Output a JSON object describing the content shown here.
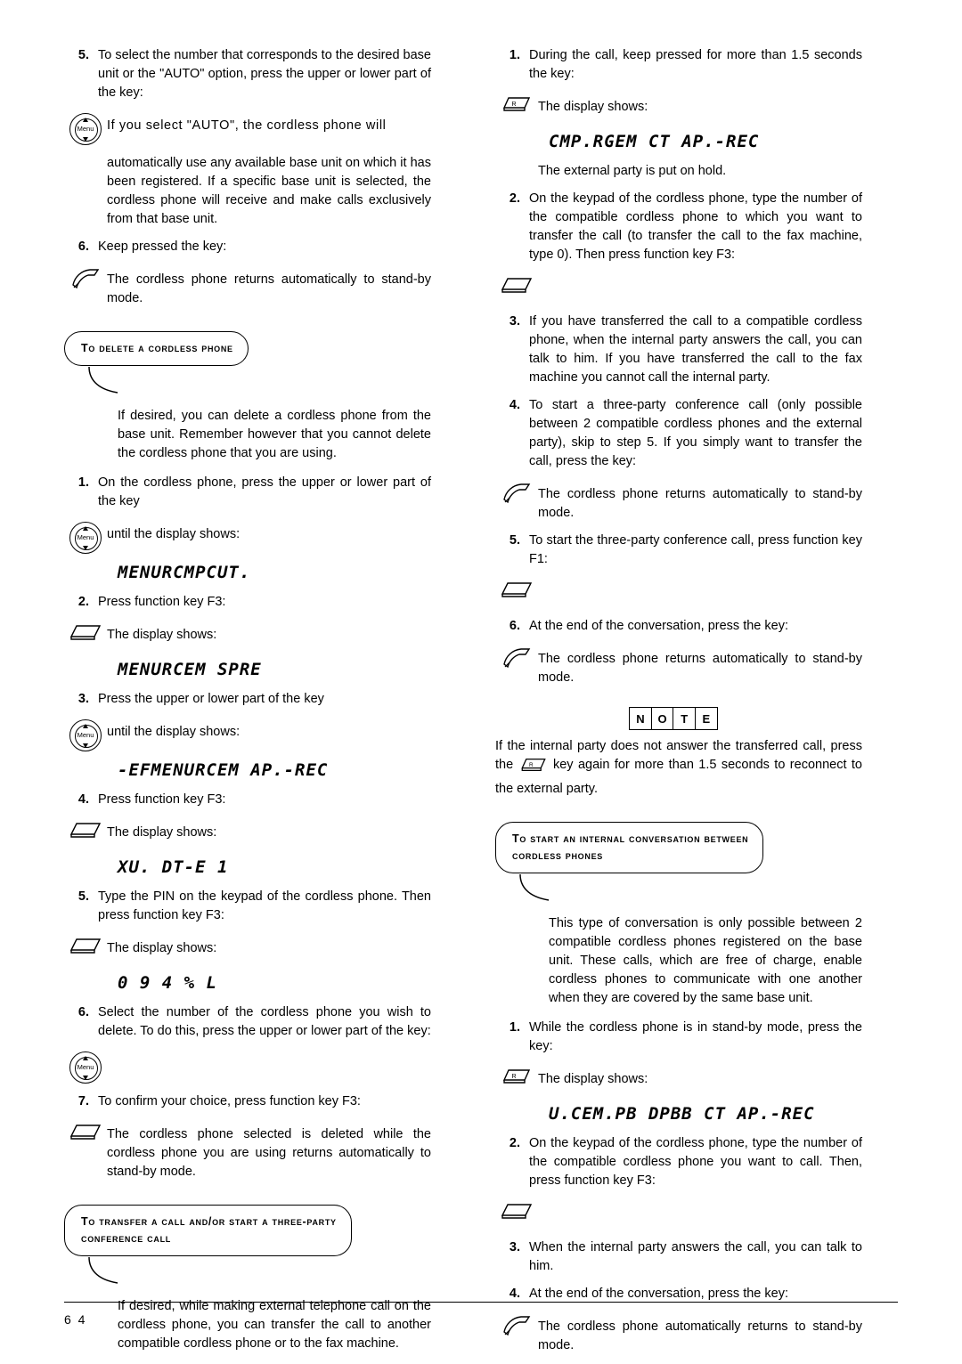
{
  "page": {
    "number": "6 4"
  },
  "left": {
    "items": [
      {
        "type": "num",
        "num": "5.",
        "text": "To select the number that corresponds to the desired base unit or the \"AUTO\" option, press the upper or lower part of the key:"
      },
      {
        "type": "icon",
        "icon": "menu-navigation-key-icon",
        "text": "If you select \"AUTO\", the cordless phone will"
      },
      {
        "type": "plain",
        "text": "automatically use any available base unit on which it has been registered. If a specific base unit is selected, the cordless phone will receive and make calls exclusively from that base unit."
      },
      {
        "type": "num",
        "num": "6.",
        "text": "Keep pressed the key:"
      },
      {
        "type": "icon",
        "icon": "hook-hangup-key-icon",
        "text": "The cordless phone returns automatically to stand-by mode."
      }
    ],
    "section1": {
      "heading": "To delete a cordless phone",
      "body": "If desired, you can delete a cordless phone from the base unit. Remember however that you cannot delete the cordless phone that you are using.",
      "items": [
        {
          "type": "num",
          "num": "1.",
          "text": "On the cordless phone, press the upper or lower part of the key"
        },
        {
          "type": "icon",
          "icon": "menu-navigation-key-icon",
          "text": "until the display shows:"
        },
        {
          "type": "lcd",
          "text": "MENURCMPCUT."
        },
        {
          "type": "num",
          "num": "2.",
          "text": "Press function key F3:"
        },
        {
          "type": "icon",
          "icon": "function-key-f3-icon",
          "text": "The display shows:"
        },
        {
          "type": "lcd",
          "text": "MENURCEM SPRE"
        },
        {
          "type": "num",
          "num": "3.",
          "text": "Press the upper or lower part of the key"
        },
        {
          "type": "icon",
          "icon": "menu-navigation-key-icon",
          "text": "until the display shows:"
        },
        {
          "type": "lcd",
          "text": "-EFMENURCEM AP.-REC"
        },
        {
          "type": "num",
          "num": "4.",
          "text": "Press function key F3:"
        },
        {
          "type": "icon",
          "icon": "function-key-f3-icon",
          "text": "The display shows:"
        },
        {
          "type": "lcd",
          "text": "XU. DT-E 1"
        },
        {
          "type": "num",
          "num": "5.",
          "text": "Type the PIN on the keypad of the cordless phone. Then press function key F3:"
        },
        {
          "type": "icon",
          "icon": "function-key-f3-icon",
          "text": "The display shows:"
        },
        {
          "type": "lcd",
          "text": "0 9 4 % L"
        },
        {
          "type": "num",
          "num": "6.",
          "text": "Select the number of the cordless phone you wish to delete. To do this, press the upper or lower part of the key:"
        },
        {
          "type": "icononly",
          "icon": "menu-navigation-key-icon",
          "text": ""
        },
        {
          "type": "num",
          "num": "7.",
          "text": "To confirm your choice, press function key F3:"
        },
        {
          "type": "icon",
          "icon": "function-key-f3-icon",
          "text": "The cordless phone selected is deleted while the cordless phone you are using returns automatically to stand-by mode."
        }
      ]
    },
    "section2": {
      "heading_line1": "To transfer a call and/or start a three-party",
      "heading_line2": "conference call",
      "body": "If desired, while making external telephone call on the cordless phone, you can transfer the call to another compatible cordless phone or to the fax machine."
    }
  },
  "right": {
    "items": [
      {
        "type": "num",
        "num": "1.",
        "text": "During the call, keep pressed for more than 1.5 seconds the key:"
      },
      {
        "type": "icon",
        "icon": "r-recall-key-icon",
        "text": "The display shows:"
      },
      {
        "type": "lcd",
        "text": "CMP.RGEM CT AP.-REC"
      },
      {
        "type": "plain",
        "text": "The external party is put on hold."
      },
      {
        "type": "num",
        "num": "2.",
        "text": "On the keypad of the cordless phone, type the number of the compatible cordless phone to which you want to transfer the call (to transfer the call to the fax machine, type 0). Then press function key F3:"
      },
      {
        "type": "icononly",
        "icon": "function-key-f3-icon",
        "text": ""
      },
      {
        "type": "num",
        "num": "3.",
        "text": "If you have transferred the call to a compatible cordless phone, when the internal party answers the call, you can talk to him. If you have transferred the call to the fax machine you cannot call the internal party."
      },
      {
        "type": "num",
        "num": "4.",
        "text": "To start a three-party conference call (only possible between 2 compatible cordless phones and the external party), skip to step 5. If you simply want to transfer the call, press the key:"
      },
      {
        "type": "icon",
        "icon": "hook-hangup-key-icon",
        "text": "The cordless phone returns automatically to stand-by mode."
      },
      {
        "type": "num",
        "num": "5.",
        "text": "To start the three-party conference call, press function key F1:"
      },
      {
        "type": "icononly",
        "icon": "function-key-f1-icon",
        "text": ""
      },
      {
        "type": "num",
        "num": "6.",
        "text": "At the end of the conversation, press the key:"
      },
      {
        "type": "icon",
        "icon": "hook-hangup-key-icon",
        "text": "The cordless phone returns automatically to stand-by mode."
      }
    ],
    "note": {
      "letters": [
        "N",
        "O",
        "T",
        "E"
      ],
      "text_before": "If the internal party does not answer the transferred call, press the ",
      "text_after": " key again for more than 1.5 seconds to reconnect to the external party."
    },
    "section": {
      "heading_line1": "To start an internal conversation between",
      "heading_line2": "cordless phones",
      "body": "This type of conversation is only possible between 2 compatible cordless phones registered on the base unit. These calls, which are free of charge, enable cordless phones to communicate with one another when they are covered by the same base unit.",
      "items": [
        {
          "type": "num",
          "num": "1.",
          "text": "While the cordless phone is in stand-by mode, press the key:"
        },
        {
          "type": "icon",
          "icon": "r-recall-key-icon",
          "text": "The display shows:"
        },
        {
          "type": "lcd",
          "text": "U.CEM.PB DPBB CT AP.-REC"
        },
        {
          "type": "num",
          "num": "2.",
          "text": "On the keypad of the cordless phone, type the number of the compatible cordless phone you want to call. Then, press function key F3:"
        },
        {
          "type": "icononly",
          "icon": "function-key-f3-icon",
          "text": ""
        },
        {
          "type": "num",
          "num": "3.",
          "text": "When the internal party answers the call, you can talk to him."
        },
        {
          "type": "num",
          "num": "4.",
          "text": "At the end of the conversation, press the key:"
        },
        {
          "type": "icon",
          "icon": "hook-hangup-key-icon",
          "text": "The cordless phone automatically returns to stand-by mode."
        }
      ]
    }
  }
}
